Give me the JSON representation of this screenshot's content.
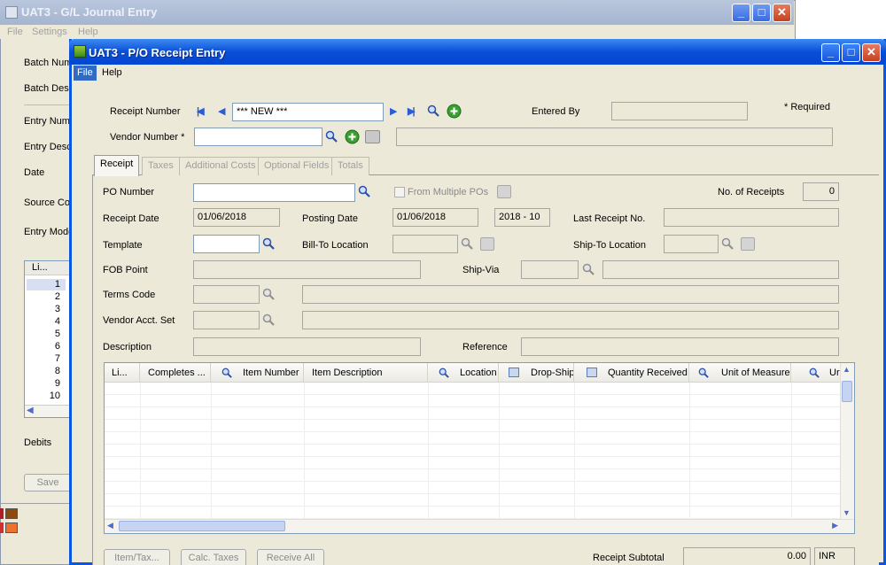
{
  "gl_window": {
    "title": "UAT3 - G/L Journal Entry",
    "menu": [
      "File",
      "Settings",
      "Help"
    ],
    "labels": [
      "Batch Num",
      "Batch Des",
      "Entry Numb",
      "Entry Desc",
      "Date",
      "Source Co",
      "Entry Mode"
    ],
    "list_header": "Li...",
    "list_rows": [
      "1",
      "2",
      "3",
      "4",
      "5",
      "6",
      "7",
      "8",
      "9",
      "10"
    ],
    "debits_label": "Debits",
    "save_label": "Save"
  },
  "po_window": {
    "title": "UAT3 - P/O Receipt Entry",
    "menu": [
      "File",
      "Help"
    ],
    "receipt_number_label": "Receipt Number",
    "receipt_number_value": "*** NEW ***",
    "entered_by_label": "Entered By",
    "required_note": "*  Required",
    "vendor_number_label": "Vendor Number *",
    "tabs": [
      "Receipt",
      "Taxes",
      "Additional Costs",
      "Optional Fields",
      "Totals"
    ],
    "po_number_label": "PO Number",
    "from_multiple_pos_label": "From Multiple POs",
    "no_of_receipts_label": "No. of Receipts",
    "no_of_receipts_value": "0",
    "receipt_date_label": "Receipt Date",
    "receipt_date_value": "01/06/2018",
    "posting_date_label": "Posting Date",
    "posting_date_value": "01/06/2018",
    "fiscal_period_value": "2018 - 10",
    "last_receipt_no_label": "Last Receipt No.",
    "template_label": "Template",
    "bill_to_location_label": "Bill-To Location",
    "ship_to_location_label": "Ship-To Location",
    "fob_point_label": "FOB Point",
    "ship_via_label": "Ship-Via",
    "terms_code_label": "Terms Code",
    "vendor_acct_set_label": "Vendor Acct. Set",
    "description_label": "Description",
    "reference_label": "Reference",
    "grid_columns": [
      "Li...",
      "Completes ...",
      "Item Number",
      "Item Description",
      "Location",
      "Drop-Ship",
      "Quantity Received",
      "Unit of Measure",
      "Ur"
    ],
    "buttons": {
      "item_tax": "Item/Tax...",
      "calc_taxes": "Calc. Taxes",
      "receive_all": "Receive All"
    },
    "receipt_subtotal_label": "Receipt Subtotal",
    "receipt_subtotal_value": "0.00",
    "currency_value": "INR"
  },
  "colors": {
    "title_active": "#0a4ed6",
    "title_inactive": "#a5b5d0",
    "dialog_bg": "#ece9d8",
    "add_icon": "#3aa030",
    "nav_arrow": "#2b5bd8"
  }
}
